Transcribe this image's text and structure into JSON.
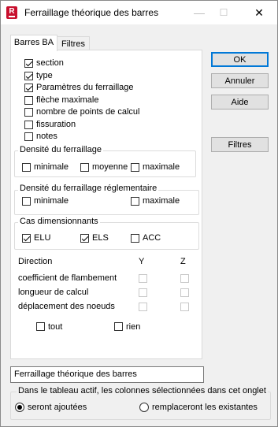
{
  "window": {
    "title": "Ferraillage théorique des barres",
    "app_icon_letter": "R",
    "minimize_glyph": "—",
    "maximize_glyph": "☐",
    "close_glyph": "✕"
  },
  "tabs": [
    "Barres BA",
    "Filtres"
  ],
  "options": [
    {
      "label": "section",
      "checked": true
    },
    {
      "label": "type",
      "checked": true
    },
    {
      "label": "Paramètres du ferraillage",
      "checked": true
    },
    {
      "label": "flèche maximale",
      "checked": false
    },
    {
      "label": "nombre de points de calcul",
      "checked": false
    },
    {
      "label": "fissuration",
      "checked": false
    },
    {
      "label": "notes",
      "checked": false
    }
  ],
  "densite": {
    "title": "Densité du ferraillage",
    "items": [
      {
        "label": "minimale",
        "checked": false
      },
      {
        "label": "moyenne",
        "checked": false
      },
      {
        "label": "maximale",
        "checked": false
      }
    ]
  },
  "densite_reglementaire": {
    "title": "Densité du ferraillage réglementaire",
    "items": [
      {
        "label": "minimale",
        "checked": false
      },
      {
        "label": "maximale",
        "checked": false
      }
    ]
  },
  "cas": {
    "title": "Cas dimensionnants",
    "items": [
      {
        "label": "ELU",
        "checked": true
      },
      {
        "label": "ELS",
        "checked": true
      },
      {
        "label": "ACC",
        "checked": false
      }
    ]
  },
  "direction": {
    "header": "Direction",
    "col_y": "Y",
    "col_z": "Z",
    "rows": [
      "coefficient de flambement",
      "longueur de calcul",
      "déplacement des noeuds"
    ],
    "tout": "tout",
    "rien": "rien"
  },
  "buttons": {
    "ok": "OK",
    "annuler": "Annuler",
    "aide": "Aide",
    "filtres": "Filtres"
  },
  "name_field": {
    "value": "Ferraillage théorique des barres"
  },
  "active_table": {
    "title": "Dans le tableau actif, les colonnes sélectionnées dans cet onglet",
    "options": [
      {
        "label": "seront ajoutées",
        "selected": true
      },
      {
        "label": "remplaceront les existantes",
        "selected": false
      }
    ]
  }
}
